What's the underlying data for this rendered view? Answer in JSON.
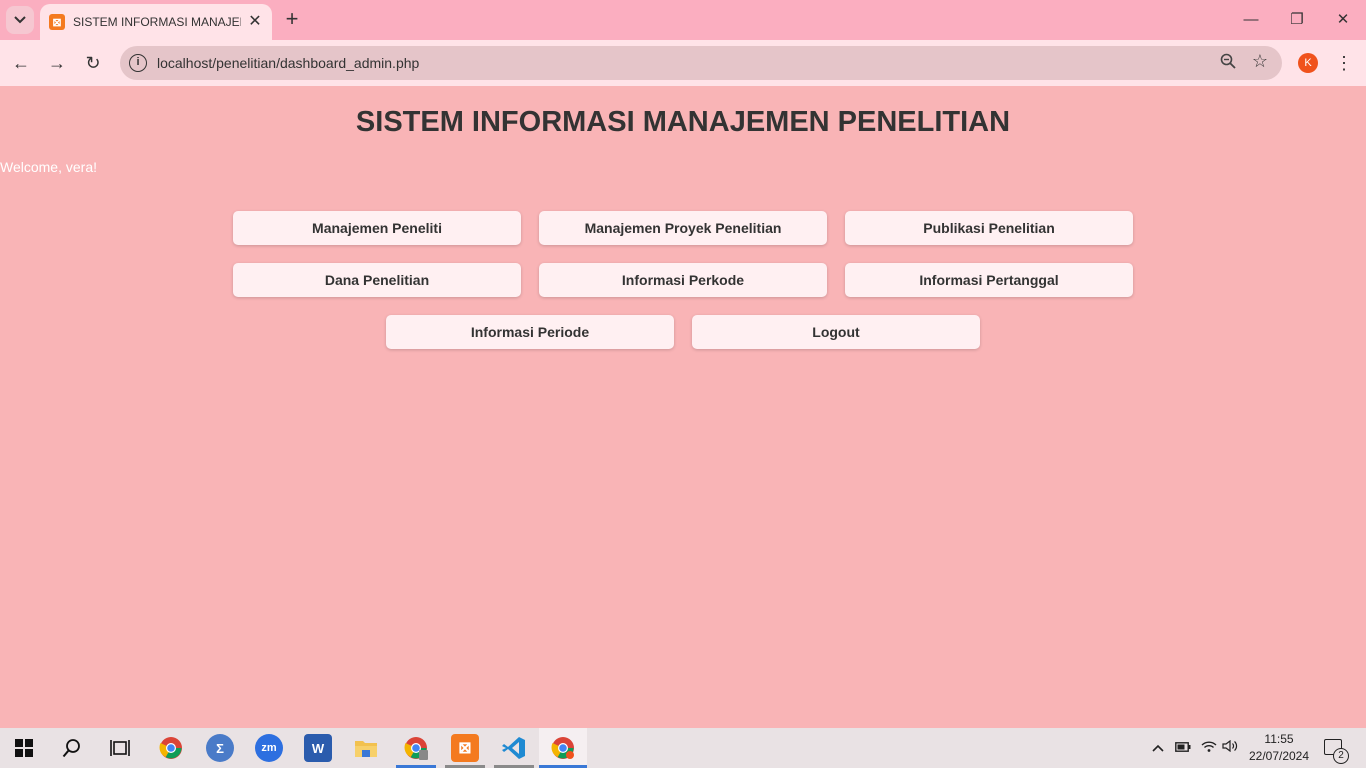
{
  "browser": {
    "tab_title": "SISTEM INFORMASI MANAJEMEN PENELITIAN",
    "url": "localhost/penelitian/dashboard_admin.php",
    "profile_initial": "K"
  },
  "page": {
    "title": "SISTEM INFORMASI MANAJEMEN PENELITIAN",
    "welcome": "Welcome, vera!",
    "buttons": [
      "Manajemen Peneliti",
      "Manajemen Proyek Penelitian",
      "Publikasi Penelitian",
      "Dana Penelitian",
      "Informasi Perkode",
      "Informasi Pertanggal",
      "Informasi Periode",
      "Logout"
    ]
  },
  "taskbar": {
    "time": "11:55",
    "date": "22/07/2024",
    "notification_count": "2",
    "zoom_label": "zm",
    "word_label": "W"
  }
}
